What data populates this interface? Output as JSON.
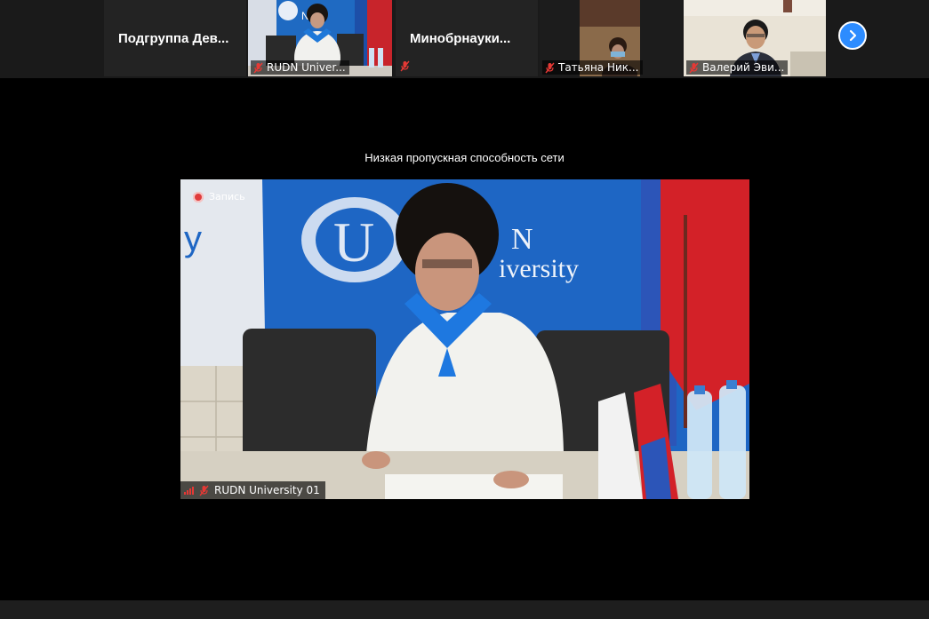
{
  "gallery": {
    "tiles": [
      {
        "name": "Подгруппа Дев...",
        "muted": false
      },
      {
        "name": "RUDN Univer...",
        "muted": true,
        "active": true
      },
      {
        "name": "Минобрнауки...",
        "muted": true
      },
      {
        "name": "Татьяна Ник...",
        "muted": true
      },
      {
        "name": "Валерий Эви...",
        "muted": true
      }
    ],
    "next_icon": "chevron-right-icon"
  },
  "main": {
    "network_notice": "Низкая пропускная способность сети",
    "recording_label": "Запись",
    "speaker_name": "RUDN University 01"
  },
  "colors": {
    "accent": "#2d8cff",
    "active_border": "#7bc043",
    "muted_red": "#e53935"
  }
}
